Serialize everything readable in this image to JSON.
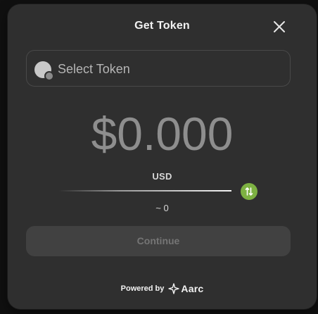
{
  "modal": {
    "title": "Get Token"
  },
  "token_select": {
    "label": "Select Token"
  },
  "amount": {
    "display": "$0.000",
    "currency": "USD",
    "approx": "~ 0"
  },
  "actions": {
    "continue_label": "Continue"
  },
  "footer": {
    "powered_by": "Powered by",
    "brand": "Aarc"
  },
  "colors": {
    "background": "#2f2f2f",
    "accent_green": "#7db142",
    "button_bg": "#414141"
  },
  "icons": {
    "close": "close-icon",
    "token": "token-placeholder-icon",
    "swap": "swap-arrows-icon",
    "brand": "aarc-logo-icon"
  }
}
